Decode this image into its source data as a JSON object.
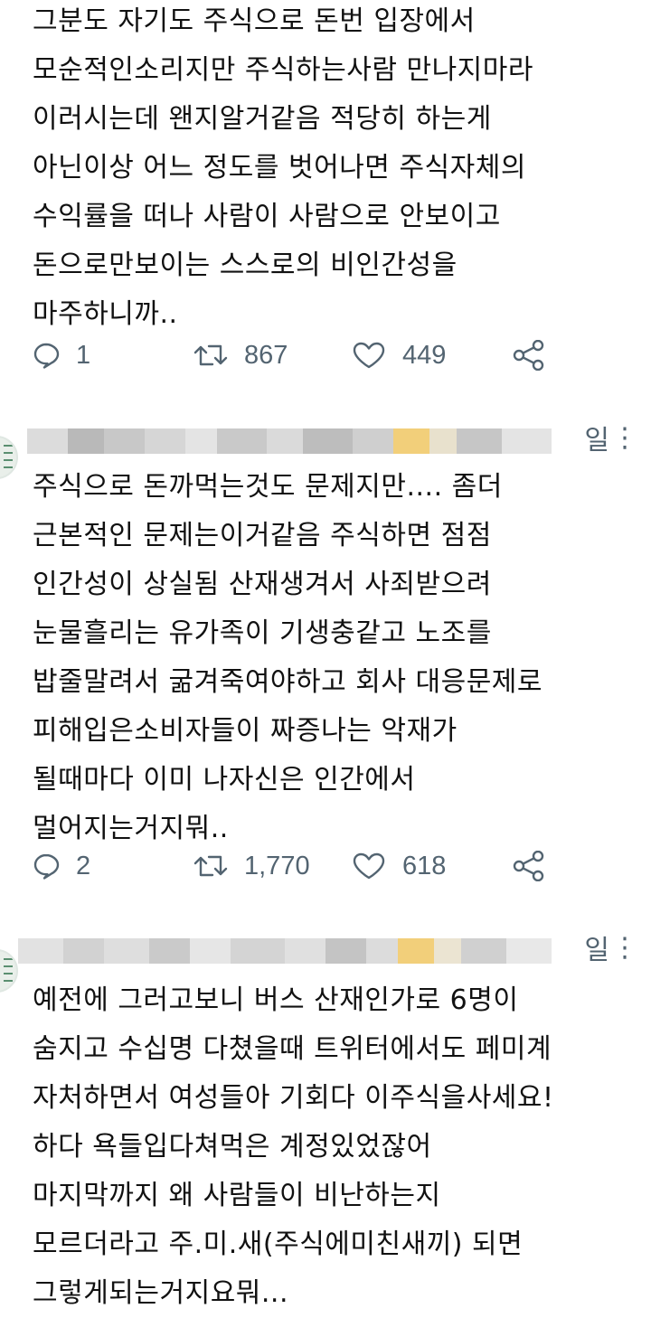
{
  "tweets": [
    {
      "date_fragment": "",
      "lines": [
        "그분도 자기도 주식으로 돈번 입장에서",
        "모순적인소리지만 주식하는사람 만나지마라",
        "이러시는데 왠지알거같음 적당히 하는게",
        "아닌이상 어느 정도를 벗어나면 주식자체의",
        "수익률을 떠나 사람이 사람으로 안보이고",
        "돈으로만보이는 스스로의 비인간성을",
        "마주하니까.."
      ],
      "replies": "1",
      "retweets": "867",
      "likes": "449"
    },
    {
      "date_fragment": "일",
      "lines": [
        "주식으로 돈까먹는것도 문제지만.... 좀더",
        "근본적인 문제는이거같음 주식하면 점점",
        "인간성이 상실됨 산재생겨서 사죄받으려",
        "눈물흘리는 유가족이 기생충같고 노조를",
        "밥줄말려서 굶겨죽여야하고 회사 대응문제로",
        "피해입은소비자들이 짜증나는 악재가",
        "될때마다 이미 나자신은 인간에서",
        "멀어지는거지뭐.."
      ],
      "replies": "2",
      "retweets": "1,770",
      "likes": "618"
    },
    {
      "date_fragment": "일",
      "lines": [
        "예전에 그러고보니 버스 산재인가로 6명이",
        "숨지고 수십명 다쳤을때 트위터에서도 페미계",
        "자처하면서 여성들아 기회다 이주식을사세요!",
        "하다 욕들입다쳐먹은 계정있었잖어",
        "마지막까지 왜 사람들이 비난하는지",
        "모르더라고 주.미.새(주식에미친새끼) 되면",
        "그렇게되는거지요뭐..."
      ]
    }
  ],
  "more_glyph": "⋮",
  "colors": {
    "text": "#111111",
    "muted": "#536471",
    "blur_accent": "#f2cf7a"
  }
}
